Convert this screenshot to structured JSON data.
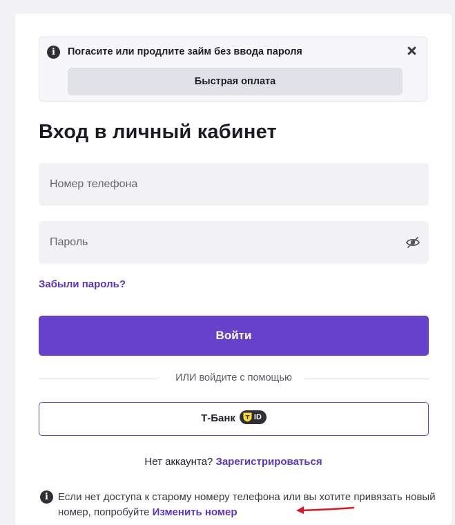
{
  "notice": {
    "icon": "info-icon",
    "text": "Погасите или продлите займ без ввода пароля",
    "quick_pay_label": "Быстрая оплата",
    "close_icon": "close-icon"
  },
  "title": "Вход в личный кабинет",
  "phone_field": {
    "placeholder": "Номер телефона",
    "value": ""
  },
  "password_field": {
    "placeholder": "Пароль",
    "value": "",
    "toggle_icon": "eye-slash-icon"
  },
  "forgot_password": "Забыли пароль?",
  "login_button": "Войти",
  "divider_text": "ИЛИ войдите с помощью",
  "tbank": {
    "label": "Т-Банк",
    "badge_text": "ID",
    "badge_icon": "tbank-shield-icon"
  },
  "register": {
    "prompt": "Нет аккаунта?",
    "link": "Зарегистрироваться"
  },
  "bottom_note": {
    "icon": "info-icon",
    "text": "Если нет доступа к старому номеру телефона или вы хотите привязать новый номер, попробуйте",
    "link": "Изменить номер",
    "annotation": "red-arrow"
  },
  "colors": {
    "accent": "#6642cc",
    "link": "#5b34c9",
    "field_bg": "#f2f2f4",
    "annotation": "#e0141e",
    "tbank_yellow": "#ffdd2d"
  }
}
